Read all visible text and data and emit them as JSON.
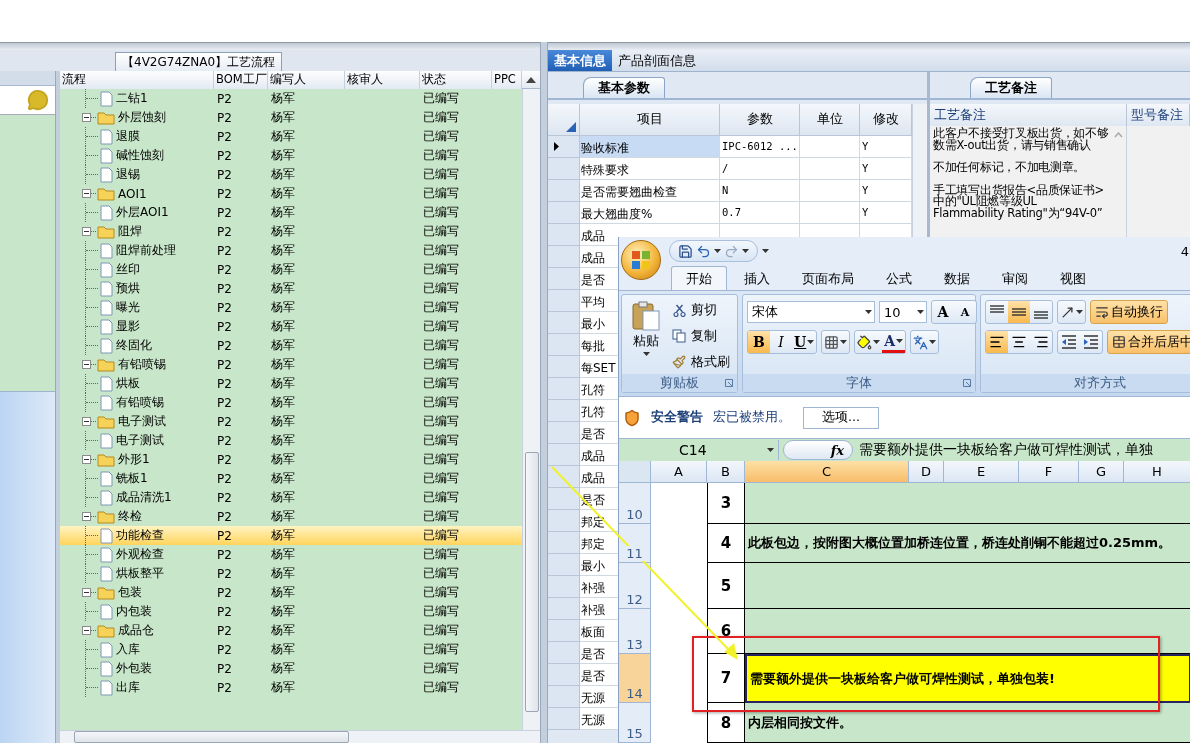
{
  "left_panel": {
    "title": "【4V2G74ZNA0】工艺流程",
    "columns": [
      "流程",
      "BOM工厂",
      "编写人",
      "核审人",
      "状态",
      "PPC"
    ],
    "tree_continued": [
      {
        "label": "二钻1",
        "bom": "P2",
        "writer": "杨军",
        "status": "已编写",
        "selected": false
      }
    ],
    "tree": [
      {
        "label": "外层蚀刻",
        "bom": "P2",
        "writer": "杨军",
        "status": "已编写",
        "selected": false,
        "expanded": true,
        "children": [
          {
            "label": "退膜",
            "bom": "P2",
            "writer": "杨军",
            "status": "已编写",
            "selected": false
          },
          {
            "label": "碱性蚀刻",
            "bom": "P2",
            "writer": "杨军",
            "status": "已编写",
            "selected": false
          },
          {
            "label": "退锡",
            "bom": "P2",
            "writer": "杨军",
            "status": "已编写",
            "selected": false
          }
        ]
      },
      {
        "label": "AOI1",
        "bom": "P2",
        "writer": "杨军",
        "status": "已编写",
        "selected": false,
        "expanded": true,
        "children": [
          {
            "label": "外层AOI1",
            "bom": "P2",
            "writer": "杨军",
            "status": "已编写",
            "selected": false
          }
        ]
      },
      {
        "label": "阻焊",
        "bom": "P2",
        "writer": "杨军",
        "status": "已编写",
        "selected": false,
        "expanded": true,
        "children": [
          {
            "label": "阻焊前处理",
            "bom": "P2",
            "writer": "杨军",
            "status": "已编写",
            "selected": false
          },
          {
            "label": "丝印",
            "bom": "P2",
            "writer": "杨军",
            "status": "已编写",
            "selected": false
          },
          {
            "label": "预烘",
            "bom": "P2",
            "writer": "杨军",
            "status": "已编写",
            "selected": false
          },
          {
            "label": "曝光",
            "bom": "P2",
            "writer": "杨军",
            "status": "已编写",
            "selected": false
          },
          {
            "label": "显影",
            "bom": "P2",
            "writer": "杨军",
            "status": "已编写",
            "selected": false
          },
          {
            "label": "终固化",
            "bom": "P2",
            "writer": "杨军",
            "status": "已编写",
            "selected": false
          }
        ]
      },
      {
        "label": "有铅喷锡",
        "bom": "P2",
        "writer": "杨军",
        "status": "已编写",
        "selected": false,
        "expanded": true,
        "children": [
          {
            "label": "烘板",
            "bom": "P2",
            "writer": "杨军",
            "status": "已编写",
            "selected": false
          },
          {
            "label": "有铅喷锡",
            "bom": "P2",
            "writer": "杨军",
            "status": "已编写",
            "selected": false
          }
        ]
      },
      {
        "label": "电子测试",
        "bom": "P2",
        "writer": "杨军",
        "status": "已编写",
        "selected": false,
        "expanded": true,
        "children": [
          {
            "label": "电子测试",
            "bom": "P2",
            "writer": "杨军",
            "status": "已编写",
            "selected": false
          }
        ]
      },
      {
        "label": "外形1",
        "bom": "P2",
        "writer": "杨军",
        "status": "已编写",
        "selected": false,
        "expanded": true,
        "children": [
          {
            "label": "铣板1",
            "bom": "P2",
            "writer": "杨军",
            "status": "已编写",
            "selected": false
          },
          {
            "label": "成品清洗1",
            "bom": "P2",
            "writer": "杨军",
            "status": "已编写",
            "selected": false
          }
        ]
      },
      {
        "label": "终检",
        "bom": "P2",
        "writer": "杨军",
        "status": "已编写",
        "selected": false,
        "expanded": true,
        "children": [
          {
            "label": "功能检查",
            "bom": "P2",
            "writer": "杨军",
            "status": "已编写",
            "selected": true
          },
          {
            "label": "外观检查",
            "bom": "P2",
            "writer": "杨军",
            "status": "已编写",
            "selected": false
          },
          {
            "label": "烘板整平",
            "bom": "P2",
            "writer": "杨军",
            "status": "已编写",
            "selected": false
          }
        ]
      },
      {
        "label": "包装",
        "bom": "P2",
        "writer": "杨军",
        "status": "已编写",
        "selected": false,
        "expanded": true,
        "children": [
          {
            "label": "内包装",
            "bom": "P2",
            "writer": "杨军",
            "status": "已编写",
            "selected": false
          }
        ]
      },
      {
        "label": "成品仓",
        "bom": "P2",
        "writer": "杨军",
        "status": "已编写",
        "selected": false,
        "expanded": true,
        "children": [
          {
            "label": "入库",
            "bom": "P2",
            "writer": "杨军",
            "status": "已编写",
            "selected": false
          },
          {
            "label": "外包装",
            "bom": "P2",
            "writer": "杨军",
            "status": "已编写",
            "selected": false
          },
          {
            "label": "出库",
            "bom": "P2",
            "writer": "杨军",
            "status": "已编写",
            "selected": false
          }
        ]
      }
    ]
  },
  "right_panel": {
    "tabs": [
      {
        "label": "基本信息",
        "selected": true
      },
      {
        "label": "产品剖面信息",
        "selected": false
      }
    ],
    "params": {
      "tab": "基本参数",
      "columns": [
        "项目",
        "参数",
        "单位",
        "修改"
      ],
      "rows": [
        {
          "item": "验收标准",
          "param": "IPC-6012 ...",
          "modify": "Y",
          "selected": true
        },
        {
          "item": "特殊要求",
          "param": "/",
          "modify": "Y",
          "selected": false
        },
        {
          "item": "是否需要翘曲检查",
          "param": "N",
          "modify": "Y",
          "selected": false
        },
        {
          "item": "最大翘曲度%",
          "param": "0.7",
          "modify": "Y",
          "selected": false
        },
        {
          "item": "成品",
          "selected": false
        },
        {
          "item": "成品",
          "selected": false
        },
        {
          "item": "是否",
          "selected": false
        },
        {
          "item": "平均",
          "selected": false
        },
        {
          "item": "最小",
          "selected": false
        },
        {
          "item": "每批",
          "selected": false
        },
        {
          "item": "每SET",
          "selected": false
        },
        {
          "item": "孔符",
          "selected": false
        },
        {
          "item": "孔符",
          "selected": false
        },
        {
          "item": "是否",
          "selected": false
        },
        {
          "item": "成品",
          "selected": false
        },
        {
          "item": "成品",
          "selected": false
        },
        {
          "item": "是否",
          "selected": false
        },
        {
          "item": "邦定",
          "selected": false
        },
        {
          "item": "邦定",
          "selected": false
        },
        {
          "item": "最小",
          "selected": false
        },
        {
          "item": "补强",
          "selected": false
        },
        {
          "item": "补强",
          "selected": false
        },
        {
          "item": "板面",
          "selected": false
        },
        {
          "item": "是否",
          "selected": false
        },
        {
          "item": "是否",
          "selected": false
        },
        {
          "item": "无源",
          "selected": false
        },
        {
          "item": "无源",
          "selected": false
        }
      ]
    },
    "notes": {
      "tab": "工艺备注",
      "columns": [
        "工艺备注",
        "型号备注"
      ],
      "paragraphs": [
        "此客户不接受打叉板出货，如不够数需X-out出货，请与销售确认",
        "不加任何标记，不加电测章。",
        "手工填写出货报告<品质保证书>中的\"UL阻燃等级UL Flammability Rating\"为“94V-0”"
      ]
    }
  },
  "excel": {
    "title_fragment": "4",
    "tabs": [
      {
        "label": "开始",
        "selected": true
      },
      {
        "label": "插入",
        "selected": false
      },
      {
        "label": "页面布局",
        "selected": false
      },
      {
        "label": "公式",
        "selected": false
      },
      {
        "label": "数据",
        "selected": false
      },
      {
        "label": "审阅",
        "selected": false
      },
      {
        "label": "视图",
        "selected": false
      }
    ],
    "clipboard": {
      "paste": "粘贴",
      "cut": "剪切",
      "copy": "复制",
      "format_painter": "格式刷",
      "label": "剪贴板"
    },
    "font": {
      "name": "宋体",
      "size": "10",
      "grow": "A",
      "shrink": "A",
      "bold": {
        "label": "B",
        "on": true
      },
      "italic": "I",
      "underline": "U",
      "font_color": "A",
      "label": "字体"
    },
    "alignment": {
      "vertical": [
        {
          "kind": "top",
          "on": false
        },
        {
          "kind": "middle",
          "on": true
        },
        {
          "kind": "bottom",
          "on": false
        }
      ],
      "horizontal": [
        {
          "kind": "left",
          "on": true
        },
        {
          "kind": "center",
          "on": false
        },
        {
          "kind": "right",
          "on": false
        }
      ],
      "wrap": {
        "label": "自动换行",
        "on": true
      },
      "merge": {
        "label": "合并后居中",
        "on": true
      },
      "label": "对齐方式"
    },
    "security": {
      "title": "安全警告",
      "message": "宏已被禁用。",
      "button": "选项..."
    },
    "formula": {
      "cell": "C14",
      "fx": "fx",
      "value": "需要额外提供一块板给客户做可焊性测试，单独"
    },
    "columns": [
      {
        "label": "A",
        "selected": false
      },
      {
        "label": "B",
        "selected": false
      },
      {
        "label": "C",
        "selected": true
      },
      {
        "label": "D",
        "selected": false
      },
      {
        "label": "E",
        "selected": false
      },
      {
        "label": "F",
        "selected": false
      },
      {
        "label": "G",
        "selected": false
      },
      {
        "label": "H",
        "selected": false
      }
    ],
    "rows": [
      {
        "number": "10",
        "index": "3",
        "selected": false,
        "highlighted": false
      },
      {
        "number": "11",
        "index": "4",
        "text": "此板包边，按附图大概位置加桥连位置，桥连处削铜不能超过0.25mm。",
        "selected": false,
        "highlighted": false
      },
      {
        "number": "12",
        "index": "5",
        "selected": false,
        "highlighted": false
      },
      {
        "number": "13",
        "index": "6",
        "selected": false,
        "highlighted": false
      },
      {
        "number": "14",
        "index": "7",
        "text": "需要额外提供一块板给客户做可焊性测试，单独包装!",
        "selected": true,
        "highlighted": true
      },
      {
        "number": "15",
        "index": "8",
        "text": "内层相同按文件。",
        "selected": false,
        "highlighted": false
      }
    ]
  }
}
